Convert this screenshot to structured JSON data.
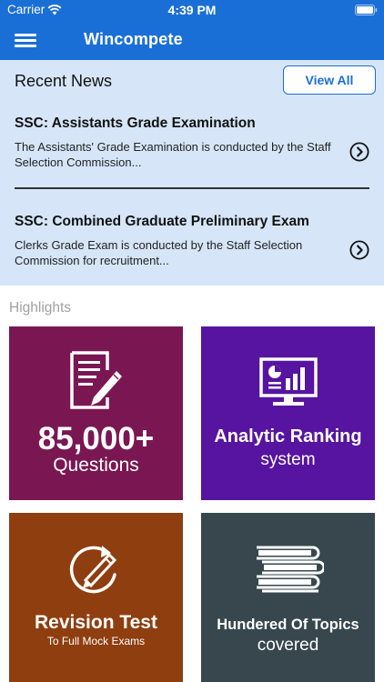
{
  "status_bar": {
    "carrier": "Carrier",
    "time": "4:39 PM"
  },
  "header": {
    "title": "Wincompete"
  },
  "news": {
    "heading": "Recent News",
    "view_all_label": "View All",
    "items": [
      {
        "title": "SSC: Assistants Grade Examination",
        "description": "The Assistants' Grade Examination is conducted by the Staff Selection Commission..."
      },
      {
        "title": "SSC: Combined Graduate Preliminary Exam",
        "description": "Clerks Grade Exam is conducted by the Staff Selection Commission for recruitment..."
      }
    ]
  },
  "highlights": {
    "label": "Highlights",
    "tiles": [
      {
        "line1": "85,000+",
        "line2": "Questions",
        "icon": "document-edit-icon",
        "color": "#7a1753"
      },
      {
        "line1": "Analytic Ranking",
        "line2": "system",
        "icon": "analytics-monitor-icon",
        "color": "#5614a0"
      },
      {
        "line1": "Revision Test",
        "line2": "To Full Mock Exams",
        "icon": "revision-pencil-icon",
        "color": "#8f3e10"
      },
      {
        "line1": "Hundered Of Topics",
        "line2": "covered",
        "icon": "books-stack-icon",
        "color": "#37474d"
      }
    ]
  }
}
